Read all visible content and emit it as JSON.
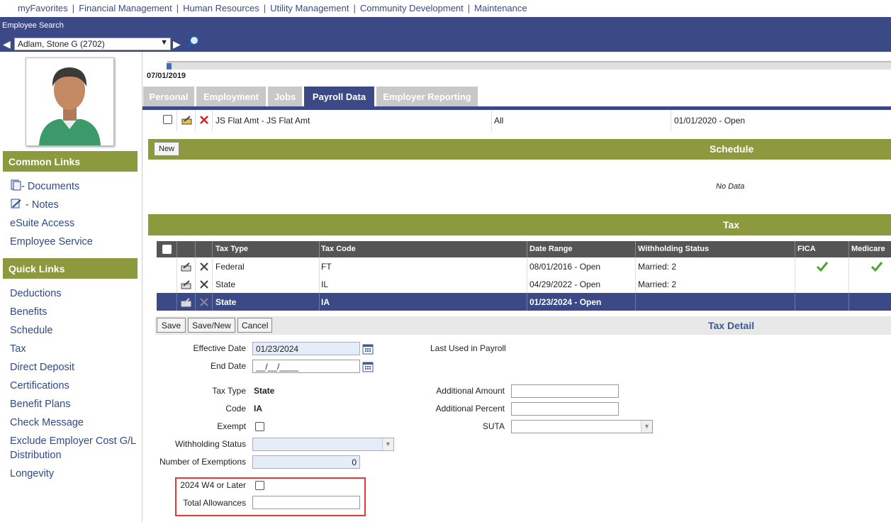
{
  "topnav": [
    "myFavorites",
    "Financial Management",
    "Human Resources",
    "Utility Management",
    "Community Development",
    "Maintenance"
  ],
  "employee": {
    "search_label": "Employee Search",
    "selected": "Adlam, Stone G (2702)"
  },
  "icons": {
    "prev": "arrow-left-icon",
    "next": "arrow-right-icon",
    "search": "magnifier-icon",
    "calendar": "calendar-icon",
    "edit": "edit-icon",
    "delete": "delete-icon",
    "check": "checkmark-icon"
  },
  "colors": {
    "nav_blue": "#3b4a86",
    "olive": "#8c9a3d",
    "link_blue": "#2f4a8a",
    "check_green": "#4aa52e",
    "highlight_red": "#e03a3a"
  },
  "common_links": {
    "title": "Common Links",
    "items": [
      "- Documents",
      "- Notes",
      "eSuite Access",
      "Employee Service"
    ]
  },
  "quick_links": {
    "title": "Quick Links",
    "items": [
      "Deductions",
      "Benefits",
      "Schedule",
      "Tax",
      "Direct Deposit",
      "Certifications",
      "Benefit Plans",
      "Check Message",
      "Exclude Employer Cost G/L Distribution",
      "Longevity"
    ]
  },
  "effective_date": "07/01/2019",
  "tabs": [
    "Personal",
    "Employment",
    "Jobs",
    "Payroll Data",
    "Employer Reporting"
  ],
  "deduction_row": {
    "name": "JS Flat Amt - JS Flat Amt",
    "scope": "All",
    "range": "01/01/2020 - Open"
  },
  "schedule": {
    "new_label": "New",
    "title": "Schedule",
    "empty": "No Data"
  },
  "tax": {
    "title": "Tax",
    "columns": [
      "Tax Type",
      "Tax Code",
      "Date Range",
      "Withholding Status",
      "FICA",
      "Medicare"
    ],
    "rows": [
      {
        "type": "Federal",
        "code": "FT",
        "range": "08/01/2016 - Open",
        "status": "Married: 2",
        "fica": true,
        "medicare": true
      },
      {
        "type": "State",
        "code": "IL",
        "range": "04/29/2022 - Open",
        "status": "Married: 2",
        "fica": false,
        "medicare": false
      },
      {
        "type": "State",
        "code": "IA",
        "range": "01/23/2024 - Open",
        "status": "",
        "fica": false,
        "medicare": false
      }
    ]
  },
  "detail": {
    "title": "Tax Detail",
    "buttons": {
      "save": "Save",
      "save_new": "Save/New",
      "cancel": "Cancel"
    },
    "effective_date_label": "Effective Date",
    "effective_date": "01/23/2024",
    "end_date_label": "End Date",
    "end_date": "__/__/____",
    "last_used_label": "Last Used in Payroll",
    "tax_type_label": "Tax Type",
    "tax_type": "State",
    "code_label": "Code",
    "code": "IA",
    "exempt_label": "Exempt",
    "withholding_label": "Withholding Status",
    "exemptions_label": "Number of Exemptions",
    "exemptions": "0",
    "w4_label": "2024 W4 or Later",
    "allowances_label": "Total Allowances",
    "add_amount_label": "Additional Amount",
    "add_percent_label": "Additional Percent",
    "suta_label": "SUTA"
  }
}
